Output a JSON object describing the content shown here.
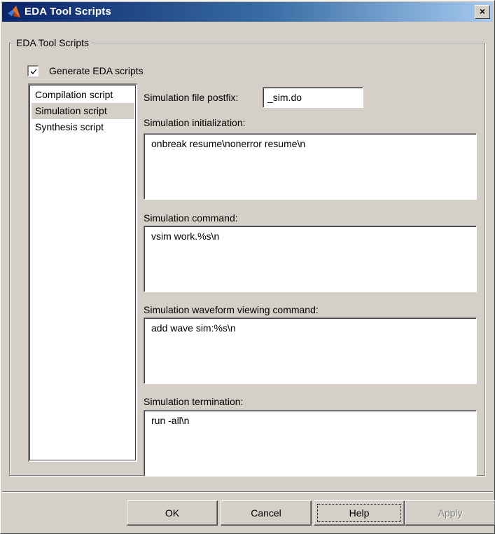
{
  "window": {
    "title": "EDA Tool Scripts",
    "close_glyph": "×",
    "title_icon": "matlab-logo-icon"
  },
  "group": {
    "legend": "EDA Tool Scripts"
  },
  "generate": {
    "label": "Generate EDA scripts",
    "checked": true
  },
  "script_list": {
    "items": [
      "Compilation script",
      "Simulation script",
      "Synthesis script"
    ],
    "selected": "Simulation script"
  },
  "postfix": {
    "label": "Simulation file postfix:",
    "value": "_sim.do"
  },
  "init": {
    "label": "Simulation initialization:",
    "value": "onbreak resume\\nonerror resume\\n"
  },
  "command": {
    "label": "Simulation command:",
    "value": "vsim work.%s\\n"
  },
  "waveform": {
    "label": "Simulation waveform viewing command:",
    "value": "add wave sim:%s\\n"
  },
  "termination": {
    "label": "Simulation termination:",
    "value": "run -all\\n"
  },
  "buttons": {
    "ok": "OK",
    "cancel": "Cancel",
    "help": "Help",
    "apply": "Apply"
  },
  "colors": {
    "titlebar_start": "#0a246a",
    "titlebar_end": "#a6caf0",
    "face": "#d4d0c8"
  }
}
